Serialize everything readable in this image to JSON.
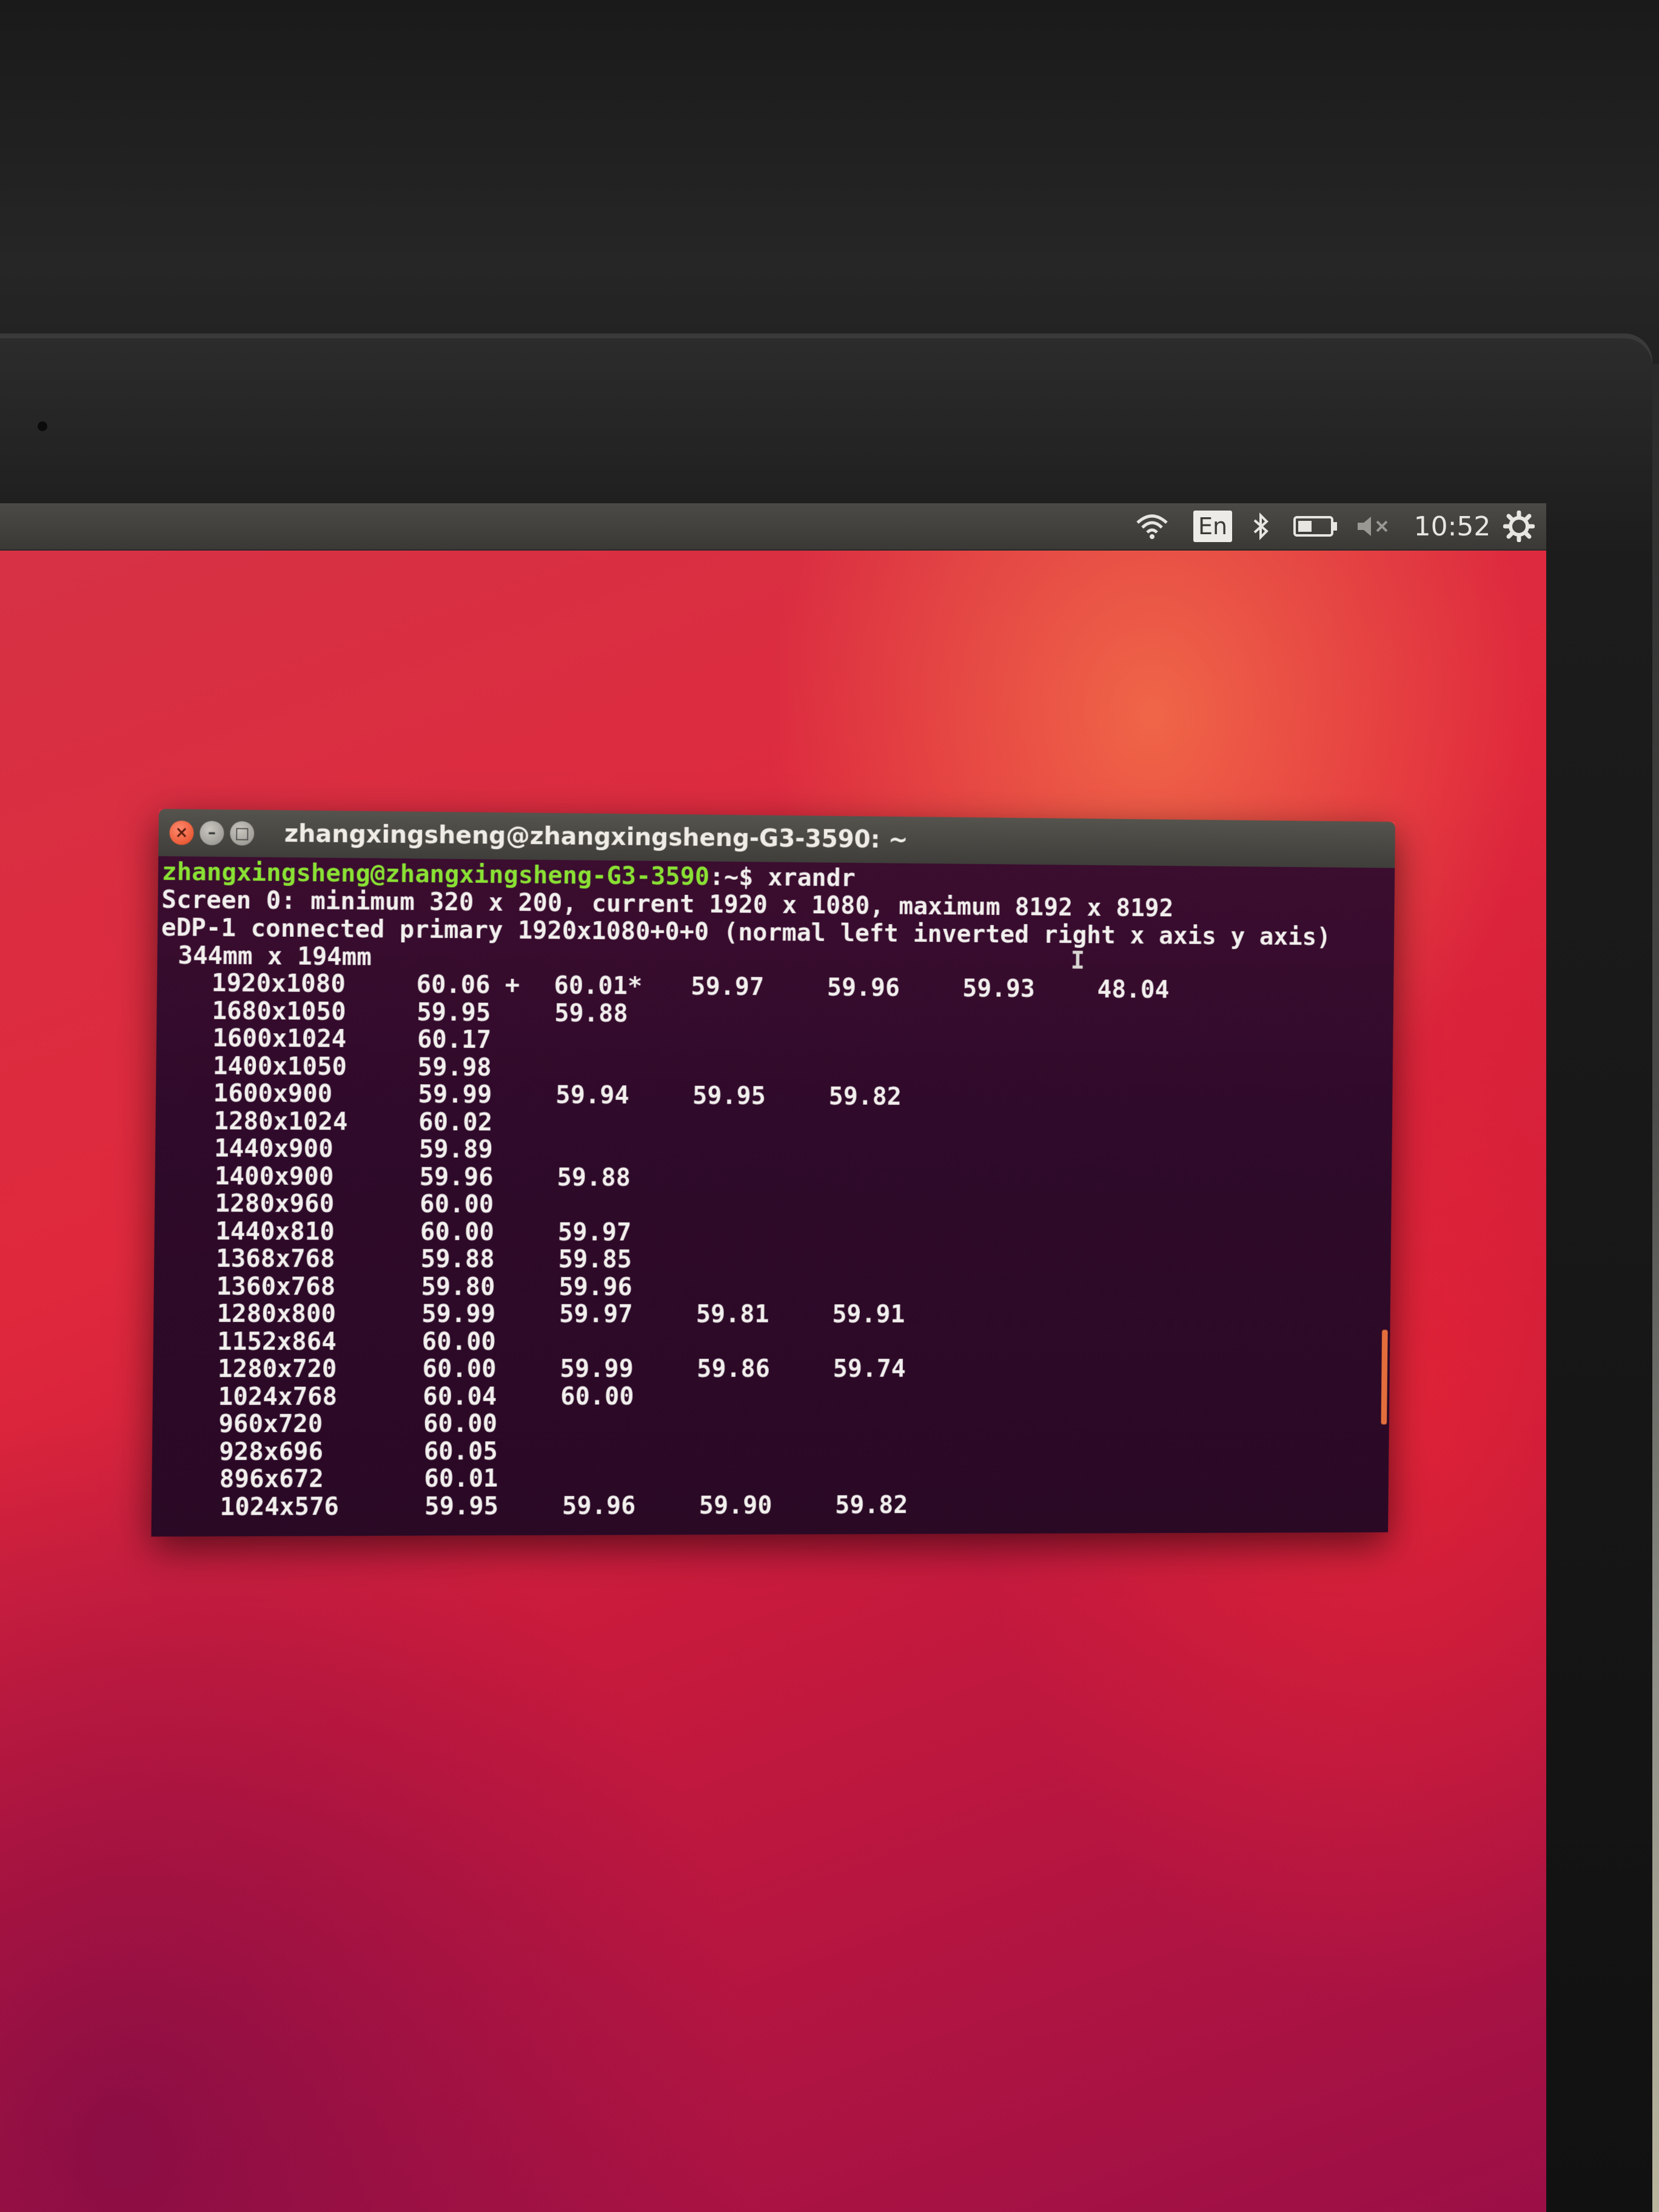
{
  "panel": {
    "language": "En",
    "clock": "10:52"
  },
  "terminal": {
    "title": "zhangxingsheng@zhangxingsheng-G3-3590: ~",
    "prompt_user": "zhangxingsheng@zhangxingsheng-G3-3590",
    "prompt_path": ":~$ ",
    "command": "xrandr",
    "screen_line": "Screen 0: minimum 320 x 200, current 1920 x 1080, maximum 8192 x 8192",
    "output_line": "eDP-1 connected primary 1920x1080+0+0 (normal left inverted right x axis y axis)",
    "size_line": "344mm x 194mm",
    "modes": [
      {
        "res": "1920x1080",
        "rates": [
          "60.06 +",
          "60.01*",
          "59.97",
          "59.96",
          "59.93",
          "48.04"
        ]
      },
      {
        "res": "1680x1050",
        "rates": [
          "59.95",
          "59.88"
        ]
      },
      {
        "res": "1600x1024",
        "rates": [
          "60.17"
        ]
      },
      {
        "res": "1400x1050",
        "rates": [
          "59.98"
        ]
      },
      {
        "res": "1600x900",
        "rates": [
          "59.99",
          "59.94",
          "59.95",
          "59.82"
        ]
      },
      {
        "res": "1280x1024",
        "rates": [
          "60.02"
        ]
      },
      {
        "res": "1440x900",
        "rates": [
          "59.89"
        ]
      },
      {
        "res": "1400x900",
        "rates": [
          "59.96",
          "59.88"
        ]
      },
      {
        "res": "1280x960",
        "rates": [
          "60.00"
        ]
      },
      {
        "res": "1440x810",
        "rates": [
          "60.00",
          "59.97"
        ]
      },
      {
        "res": "1368x768",
        "rates": [
          "59.88",
          "59.85"
        ]
      },
      {
        "res": "1360x768",
        "rates": [
          "59.80",
          "59.96"
        ]
      },
      {
        "res": "1280x800",
        "rates": [
          "59.99",
          "59.97",
          "59.81",
          "59.91"
        ]
      },
      {
        "res": "1152x864",
        "rates": [
          "60.00"
        ]
      },
      {
        "res": "1280x720",
        "rates": [
          "60.00",
          "59.99",
          "59.86",
          "59.74"
        ]
      },
      {
        "res": "1024x768",
        "rates": [
          "60.04",
          "60.00"
        ]
      },
      {
        "res": "960x720",
        "rates": [
          "60.00"
        ]
      },
      {
        "res": "928x696",
        "rates": [
          "60.05"
        ]
      },
      {
        "res": "896x672",
        "rates": [
          "60.01"
        ]
      },
      {
        "res": "1024x576",
        "rates": [
          "59.95",
          "59.96",
          "59.90",
          "59.82"
        ]
      }
    ]
  }
}
